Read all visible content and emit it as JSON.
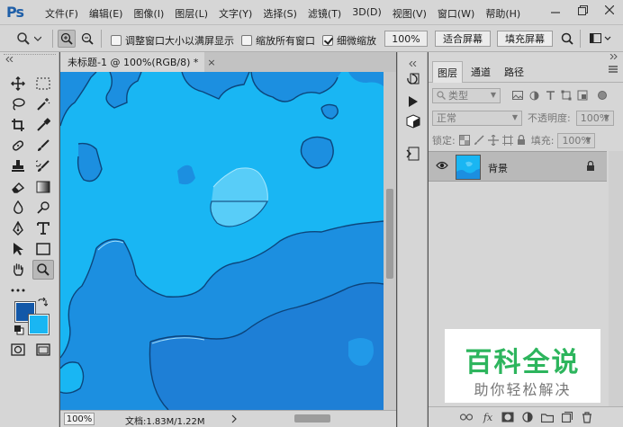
{
  "app": {
    "logo": "Ps"
  },
  "menu": [
    "文件(F)",
    "编辑(E)",
    "图像(I)",
    "图层(L)",
    "文字(Y)",
    "选择(S)",
    "滤镜(T)",
    "3D(D)",
    "视图(V)",
    "窗口(W)",
    "帮助(H)"
  ],
  "options": {
    "resize_windows": "调整窗口大小以满屏显示",
    "zoom_all_windows": "缩放所有窗口",
    "scrubby_zoom": "细微缩放",
    "zoom_value": "100%",
    "fit_screen": "适合屏幕",
    "fill_screen": "填充屏幕",
    "resize_windows_checked": false,
    "zoom_all_windows_checked": false,
    "scrubby_zoom_checked": true
  },
  "document": {
    "tab_title": "未标题-1 @ 100%(RGB/8) *",
    "close": "×",
    "zoom": "100%",
    "info": "文档:1.83M/1.22M",
    "canvas_color": "#19b6f3"
  },
  "colors": {
    "foreground": "#1358a8",
    "background": "#19b6f3"
  },
  "layers_panel": {
    "tabs": [
      "图层",
      "通道",
      "路径"
    ],
    "filter_label": "类型",
    "blend_mode": "正常",
    "opacity_label": "不透明度:",
    "opacity_value": "100%",
    "lock_label": "锁定:",
    "fill_label": "填充:",
    "fill_value": "100%",
    "layers": [
      {
        "name": "背景",
        "visible": true,
        "locked": true
      }
    ]
  },
  "watermark": {
    "title": "百科全说",
    "subtitle": "助你轻松解决"
  }
}
